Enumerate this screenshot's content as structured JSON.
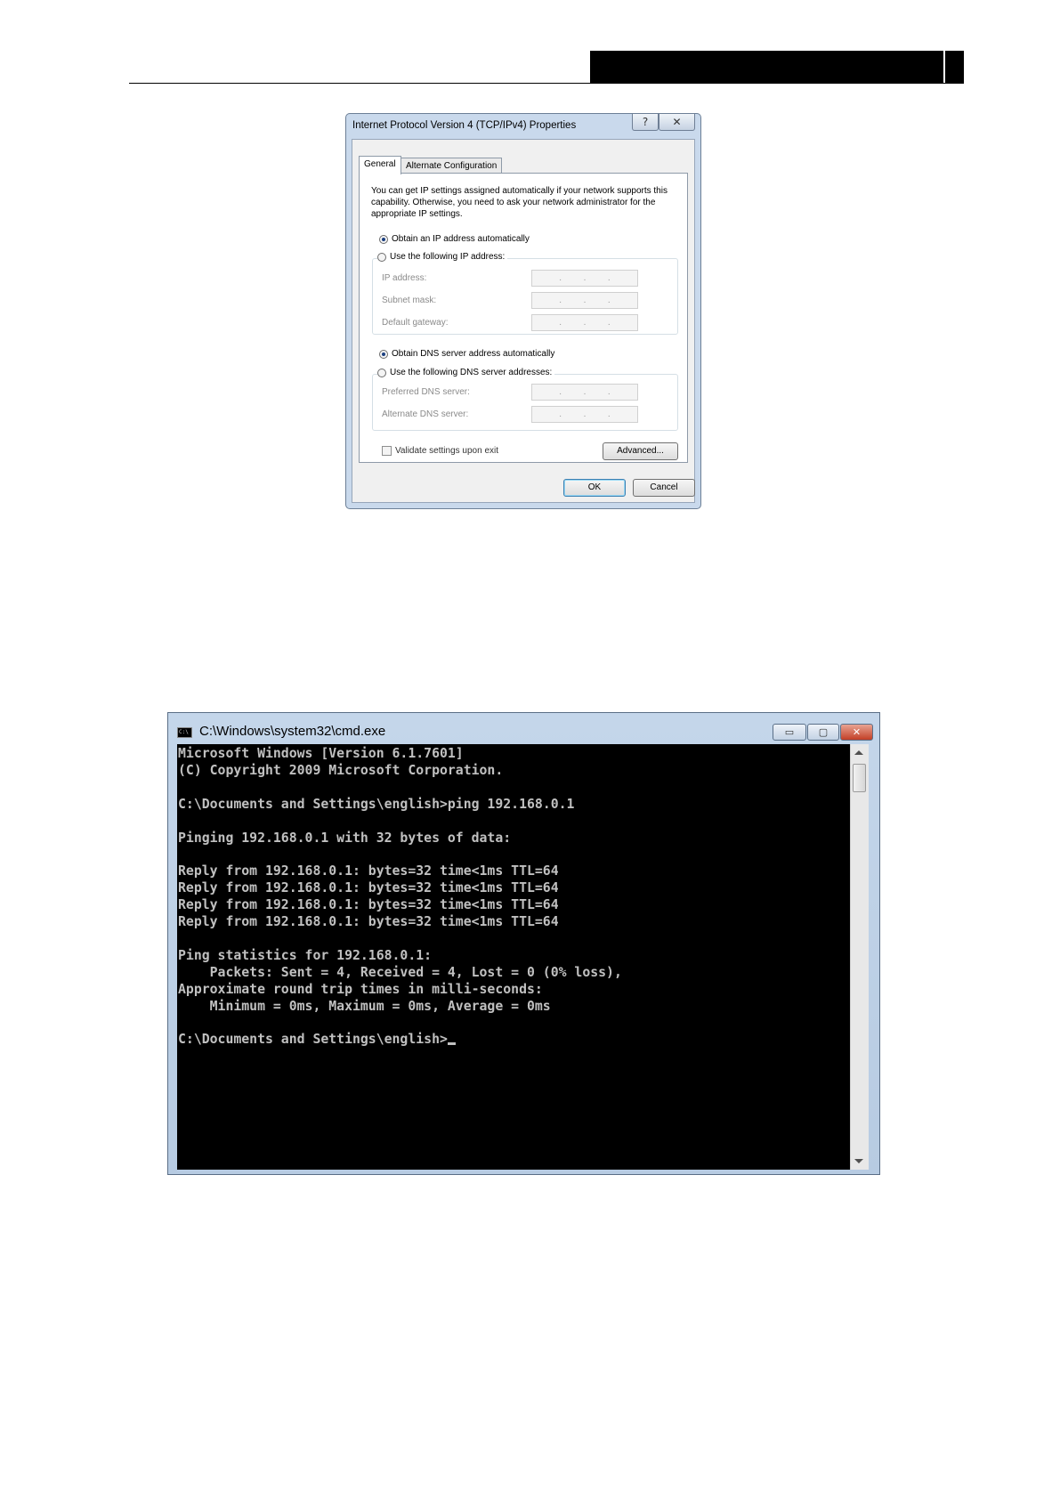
{
  "ipv4_dialog": {
    "title": "Internet Protocol Version 4 (TCP/IPv4) Properties",
    "help_button": "?",
    "close_button": "✕",
    "tabs": [
      "General",
      "Alternate Configuration"
    ],
    "description": "You can get IP settings assigned automatically if your network supports this capability. Otherwise, you need to ask your network administrator for the appropriate IP settings.",
    "ip_options": {
      "auto": "Obtain an IP address automatically",
      "manual": "Use the following IP address:",
      "selected": "auto"
    },
    "ip_fields": [
      {
        "label": "IP address:",
        "value": ". . ."
      },
      {
        "label": "Subnet mask:",
        "value": ". . ."
      },
      {
        "label": "Default gateway:",
        "value": ". . ."
      }
    ],
    "dns_options": {
      "auto": "Obtain DNS server address automatically",
      "manual": "Use the following DNS server addresses:",
      "selected": "auto"
    },
    "dns_fields": [
      {
        "label": "Preferred DNS server:",
        "value": ". . ."
      },
      {
        "label": "Alternate DNS server:",
        "value": ". . ."
      }
    ],
    "validate_label": "Validate settings upon exit",
    "validate_checked": false,
    "advanced_button": "Advanced...",
    "ok_button": "OK",
    "cancel_button": "Cancel"
  },
  "cmd_window": {
    "title": "C:\\Windows\\system32\\cmd.exe",
    "icon_text": "C:\\",
    "minimize": "▭",
    "maximize": "▢",
    "close": "✕",
    "output": "Microsoft Windows [Version 6.1.7601]\n(C) Copyright 2009 Microsoft Corporation.\n\nC:\\Documents and Settings\\english>ping 192.168.0.1\n\nPinging 192.168.0.1 with 32 bytes of data:\n\nReply from 192.168.0.1: bytes=32 time<1ms TTL=64\nReply from 192.168.0.1: bytes=32 time<1ms TTL=64\nReply from 192.168.0.1: bytes=32 time<1ms TTL=64\nReply from 192.168.0.1: bytes=32 time<1ms TTL=64\n\nPing statistics for 192.168.0.1:\n    Packets: Sent = 4, Received = 4, Lost = 0 (0% loss),\nApproximate round trip times in milli-seconds:\n    Minimum = 0ms, Maximum = 0ms, Average = 0ms\n\nC:\\Documents and Settings\\english>"
  },
  "colors": {
    "console_bg": "#000000",
    "console_fg": "#c0c0c0",
    "window_frame": "#c4d6ea",
    "close_button": "#c33f26"
  }
}
